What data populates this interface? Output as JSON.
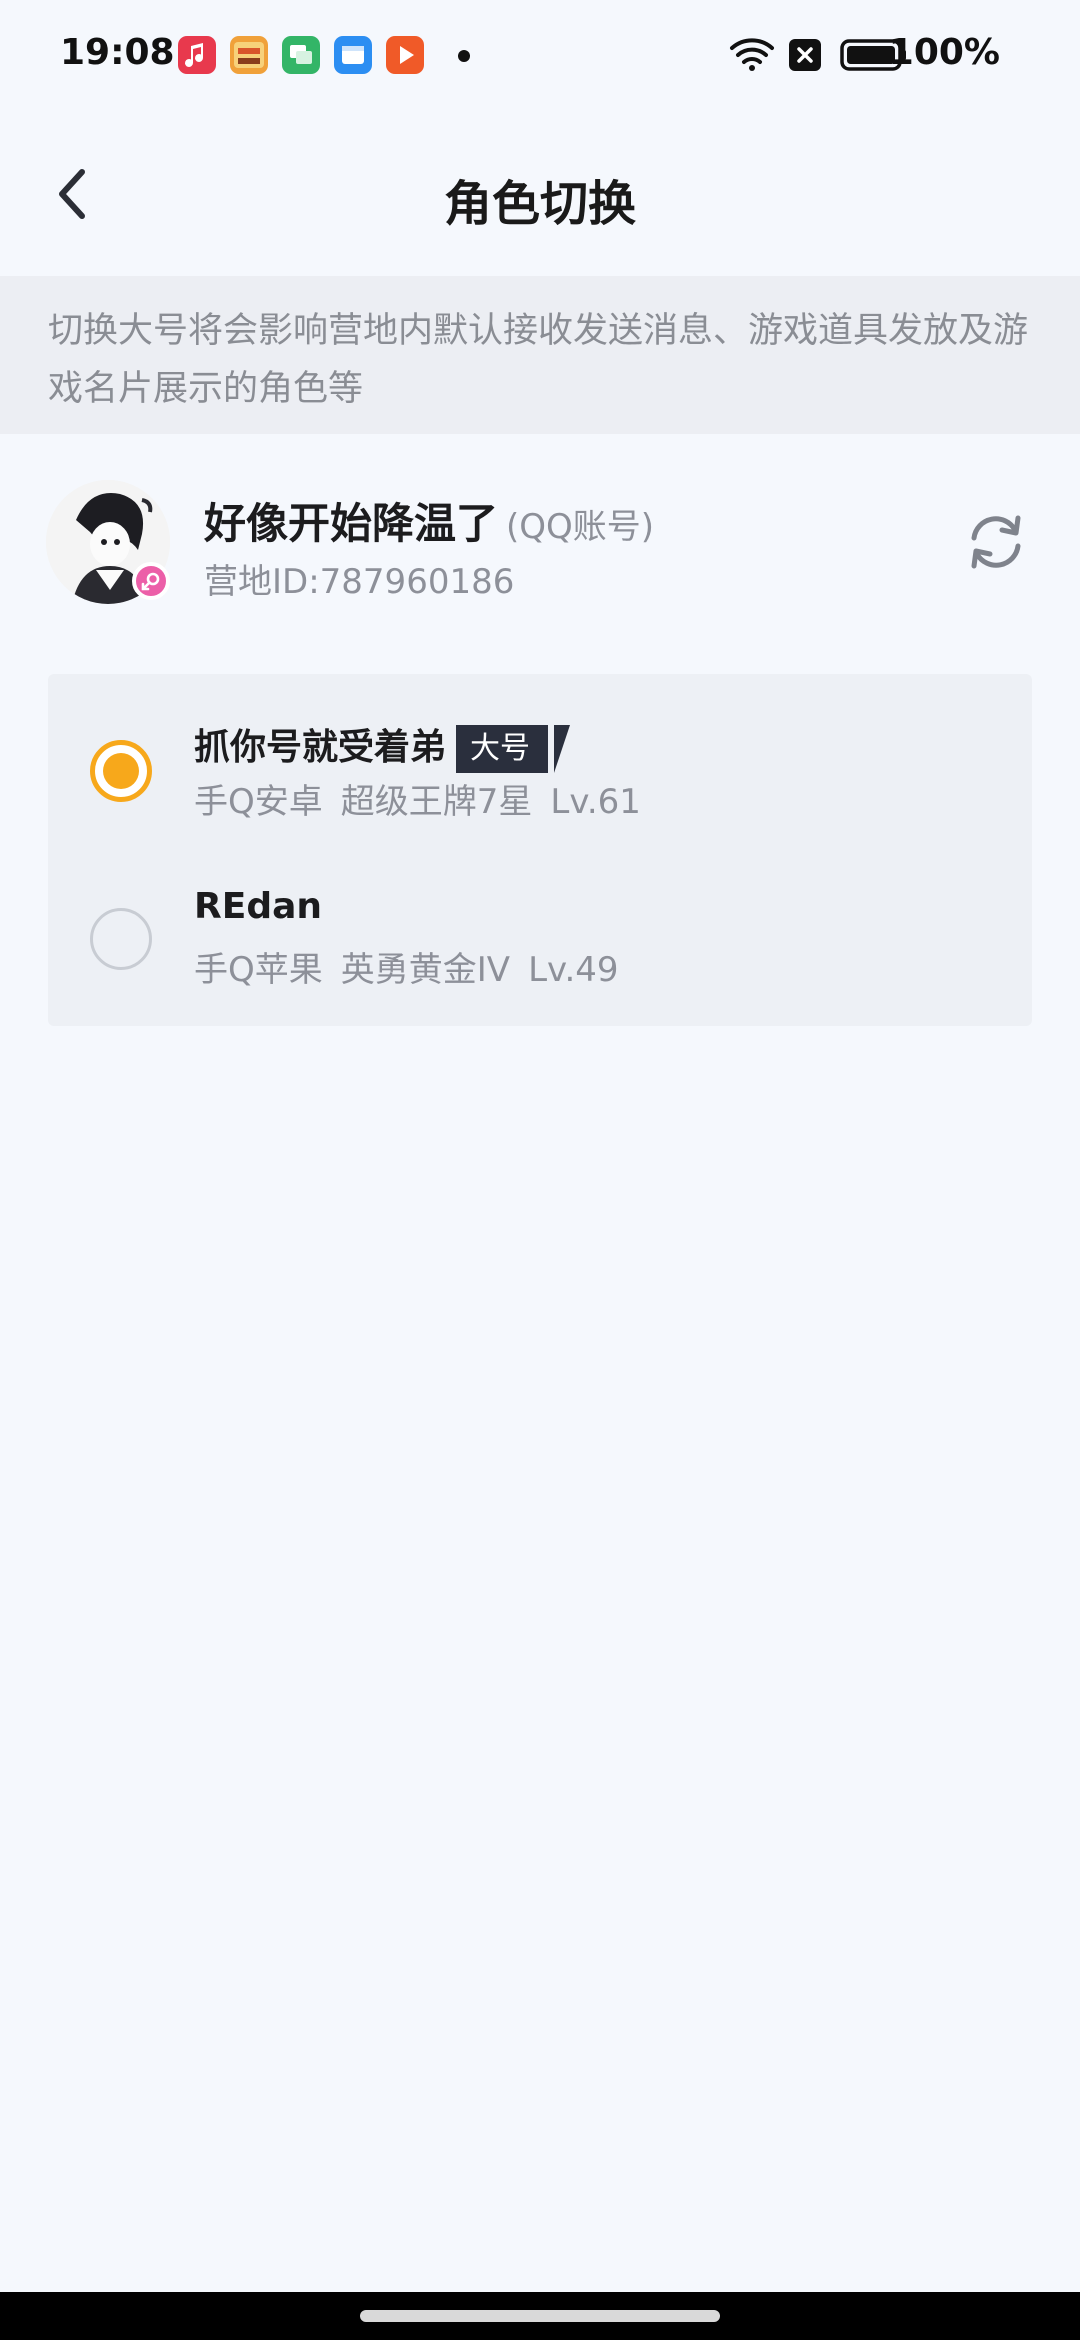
{
  "status_bar": {
    "time": "19:08",
    "battery": "100%",
    "app_icons": [
      "music-icon",
      "game-icon",
      "messages-icon",
      "files-icon",
      "video-icon"
    ]
  },
  "header": {
    "title": "角色切换"
  },
  "notice": {
    "text": "切换大号将会影响营地内默认接收发送消息、游戏道具发放及游戏名片展示的角色等"
  },
  "account": {
    "nickname": "好像开始降温了",
    "type": "(QQ账号)",
    "camp_id": "营地ID:787960186"
  },
  "roles": [
    {
      "name": "抓你号就受着弟",
      "tag": "大号",
      "platform": "手Q安卓",
      "rank": "超级王牌7星",
      "level": "Lv.61",
      "selected": true
    },
    {
      "name": "REdan",
      "tag": "",
      "platform": "手Q苹果",
      "rank": "英勇黄金IV",
      "level": "Lv.49",
      "selected": false
    }
  ],
  "colors": {
    "accent": "#f7a81b",
    "background": "#f5f8fd",
    "notice_bg": "#eceef3",
    "roles_bg": "#edf0f5",
    "tag_bg": "#2a2f3d",
    "gender_badge": "#ec5fa8"
  }
}
